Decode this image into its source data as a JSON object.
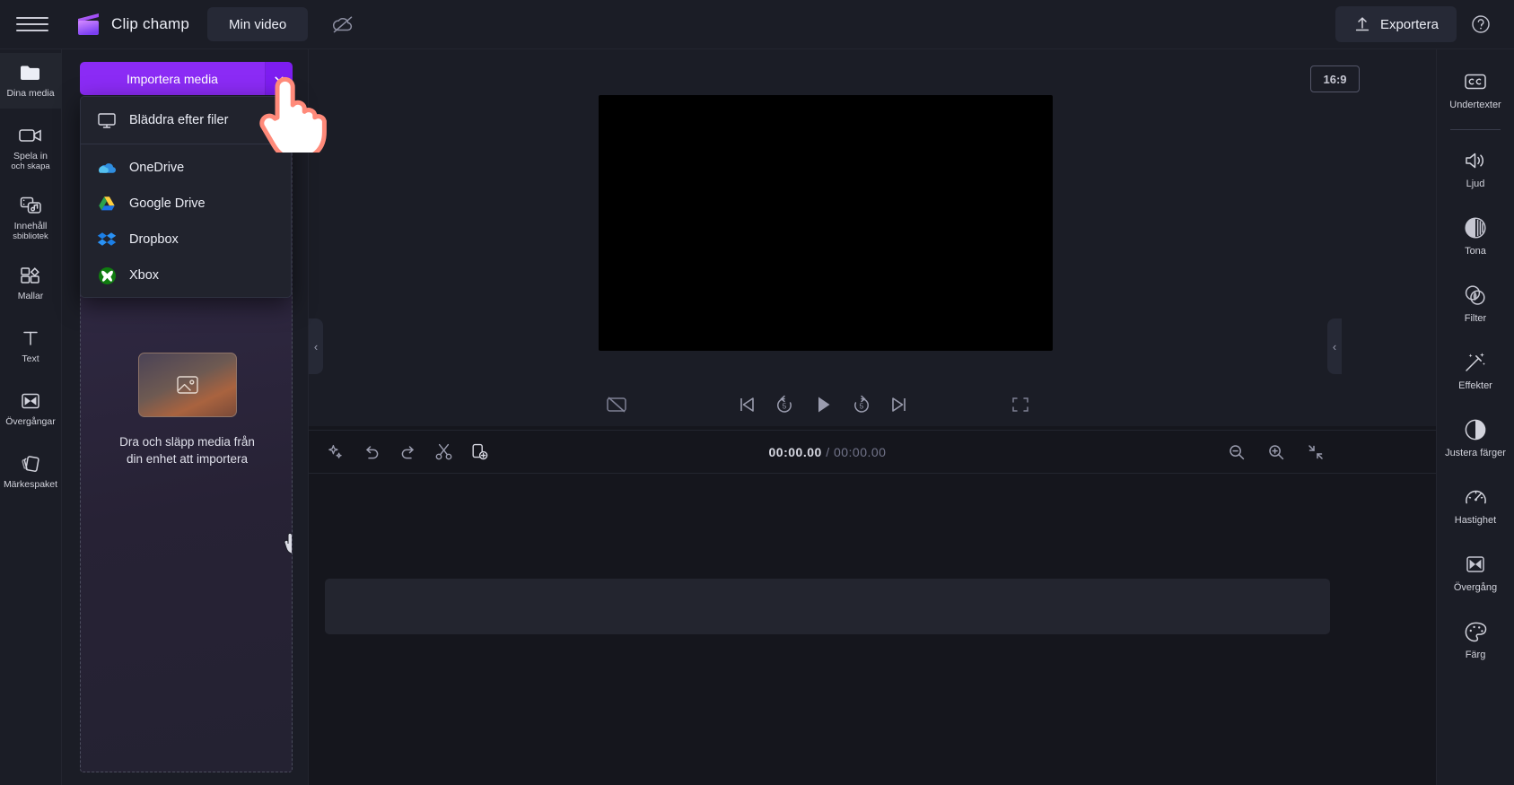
{
  "app": {
    "brand": "Clip champ",
    "project_tab": "Min video",
    "export_label": "Exportera"
  },
  "topbar": {
    "menu_icon": "hamburger-menu-icon",
    "logo_icon": "clipchamp-logo-icon",
    "cloud_off_icon": "cloud-off-icon",
    "upload_icon": "upload-arrow-icon",
    "help_icon": "help-circle-icon"
  },
  "sidebar": {
    "items": [
      {
        "label": "Dina media",
        "sub": "",
        "icon": "folder-icon",
        "active": true
      },
      {
        "label": "Spela in",
        "sub": "och skapa",
        "icon": "video-camera-icon",
        "active": false
      },
      {
        "label": "Innehåll",
        "sub": "sbibliotek",
        "icon": "content-library-icon",
        "active": false
      },
      {
        "label": "Mallar",
        "sub": "",
        "icon": "templates-grid-icon",
        "active": false
      },
      {
        "label": "Text",
        "sub": "",
        "icon": "text-t-icon",
        "active": false
      },
      {
        "label": "Övergångar",
        "sub": "",
        "icon": "transitions-icon",
        "active": false
      },
      {
        "label": "Märkespaket",
        "sub": "",
        "icon": "brand-kit-icon",
        "active": false
      }
    ]
  },
  "media_panel": {
    "import_button": "Importera media",
    "import_caret_icon": "chevron-down-icon",
    "dropzone_text_line1": "Dra och släpp media från",
    "dropzone_text_line2": "din enhet att importera",
    "dropzone_thumb_icon": "image-placeholder-icon",
    "drag_hand_icon": "drag-hand-icon"
  },
  "dropdown": {
    "items": [
      {
        "label": "Bläddra efter filer",
        "icon": "monitor-icon"
      },
      {
        "label": "OneDrive",
        "icon": "onedrive-icon"
      },
      {
        "label": "Google Drive",
        "icon": "google-drive-icon"
      },
      {
        "label": "Dropbox",
        "icon": "dropbox-icon"
      },
      {
        "label": "Xbox",
        "icon": "xbox-icon"
      }
    ],
    "cursor_icon": "pointing-hand-cursor-icon"
  },
  "preview": {
    "aspect_ratio": "16:9",
    "collapse_left_icon": "chevron-left-icon",
    "collapse_right_icon": "chevron-left-icon",
    "controls": [
      {
        "icon": "captions-off-icon",
        "name": "captions-toggle"
      },
      {
        "icon": "skip-previous-icon",
        "name": "skip-to-start"
      },
      {
        "icon": "rewind-5-icon",
        "name": "rewind-five-seconds"
      },
      {
        "icon": "play-icon",
        "name": "play-button"
      },
      {
        "icon": "forward-5-icon",
        "name": "forward-five-seconds"
      },
      {
        "icon": "skip-next-icon",
        "name": "skip-to-end"
      },
      {
        "icon": "fullscreen-icon",
        "name": "fullscreen-button"
      }
    ]
  },
  "timeline": {
    "tools": [
      {
        "icon": "magic-sparkle-icon",
        "name": "auto-enhance-button"
      },
      {
        "icon": "undo-icon",
        "name": "undo-button"
      },
      {
        "icon": "redo-icon",
        "name": "redo-button"
      },
      {
        "icon": "scissors-icon",
        "name": "split-button"
      },
      {
        "icon": "duplicate-icon",
        "name": "duplicate-button"
      }
    ],
    "current_time": "00:00.00",
    "separator": "/",
    "total_time": "00:00.00",
    "zoom_out_icon": "zoom-out-icon",
    "zoom_in_icon": "zoom-in-icon",
    "fit_icon": "fit-to-screen-icon"
  },
  "right_rail": {
    "items": [
      {
        "label": "Undertexter",
        "icon": "closed-captions-icon",
        "separator_after": true
      },
      {
        "label": "Ljud",
        "icon": "speaker-icon",
        "separator_after": false
      },
      {
        "label": "Tona",
        "icon": "fade-icon",
        "separator_after": false
      },
      {
        "label": "Filter",
        "icon": "filter-circles-icon",
        "separator_after": false
      },
      {
        "label": "Effekter",
        "icon": "effects-wand-icon",
        "separator_after": false
      },
      {
        "label": "Justera färger",
        "icon": "adjust-colors-icon",
        "separator_after": false
      },
      {
        "label": "Hastighet",
        "icon": "speed-gauge-icon",
        "separator_after": false
      },
      {
        "label": "Övergång",
        "icon": "transition-icon",
        "separator_after": false
      },
      {
        "label": "Färg",
        "icon": "palette-icon",
        "separator_after": false
      }
    ]
  },
  "colors": {
    "accent_purple": "#8B2BF5",
    "panel_bg": "#1b1d26",
    "app_bg": "#15161d",
    "cursor_outline": "#ff8a7a"
  }
}
